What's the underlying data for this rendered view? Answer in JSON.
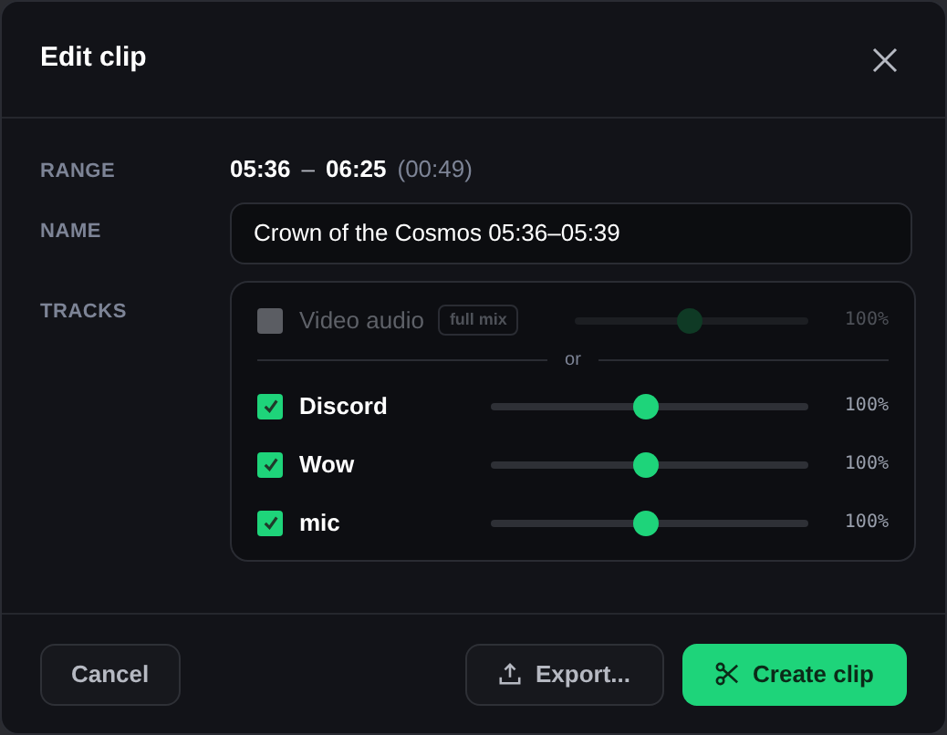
{
  "dialog": {
    "title": "Edit clip"
  },
  "range": {
    "label": "RANGE",
    "start": "05:36",
    "separator": "–",
    "end": "06:25",
    "duration": "(00:49)"
  },
  "name": {
    "label": "NAME",
    "value": "Crown of the Cosmos 05:36–05:39"
  },
  "tracks": {
    "label": "TRACKS",
    "mix": {
      "label": "Video audio",
      "tag": "full mix",
      "checked": false,
      "disabled": true,
      "level": 0.49,
      "reading": "100%"
    },
    "separator": "or",
    "sources": [
      {
        "label": "Discord",
        "checked": true,
        "disabled": false,
        "level": 0.49,
        "reading": "100%"
      },
      {
        "label": "Wow",
        "checked": true,
        "disabled": false,
        "level": 0.49,
        "reading": "100%"
      },
      {
        "label": "mic",
        "checked": true,
        "disabled": false,
        "level": 0.49,
        "reading": "100%"
      }
    ]
  },
  "buttons": [
    {
      "kind": "secondary",
      "label": "Cancel"
    },
    {
      "kind": "export",
      "label": "Export..."
    },
    {
      "kind": "primary",
      "label": "Create clip"
    }
  ]
}
